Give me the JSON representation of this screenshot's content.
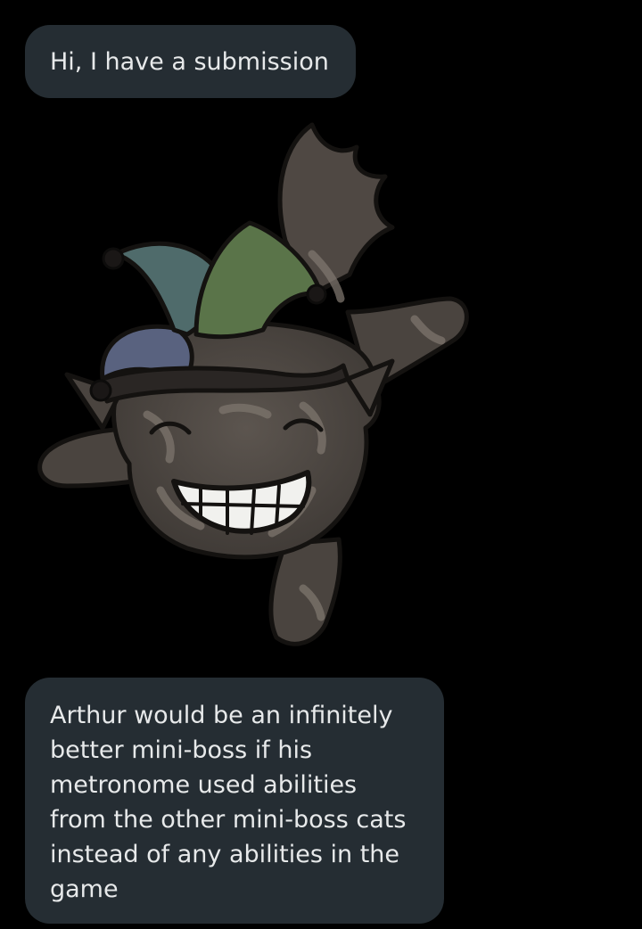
{
  "messages": [
    {
      "text": "Hi, I have a submission"
    },
    {
      "lines": [
        "Arthur would be an infinitely",
        "better mini-boss if his",
        "metronome used abilities",
        "from the other mini-boss cats",
        "instead of any abilities in the",
        "game"
      ]
    }
  ],
  "sticker": {
    "icon": "jester-cat-sticker",
    "colors": {
      "fur": "#4a443f",
      "fur_light": "#6e6660",
      "stripe": "#7d756d",
      "outline": "#141210",
      "hat_blue": "#59627f",
      "hat_teal": "#4f6b6b",
      "hat_green": "#5a7449",
      "teeth": "#f1f1ee"
    }
  },
  "theme": {
    "background": "#000000",
    "bubble": "#252d33",
    "text": "#e7e9ea"
  }
}
